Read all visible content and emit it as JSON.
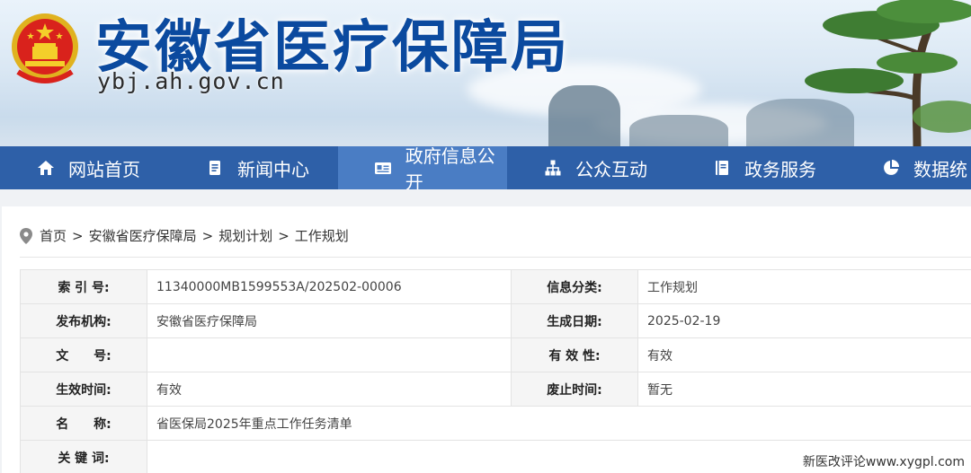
{
  "header": {
    "title": "安徽省医疗保障局",
    "domain": "ybj.ah.gov.cn"
  },
  "nav": {
    "items": [
      {
        "label": "网站首页",
        "icon": "home-icon"
      },
      {
        "label": "新闻中心",
        "icon": "document-icon"
      },
      {
        "label": "政府信息公开",
        "icon": "id-card-icon"
      },
      {
        "label": "公众互动",
        "icon": "sitemap-icon"
      },
      {
        "label": "政务服务",
        "icon": "book-icon"
      },
      {
        "label": "数据统",
        "icon": "pie-chart-icon"
      }
    ],
    "active_index": 2,
    "active_color": "#4a7dc4",
    "bar_color": "#2e60a8"
  },
  "breadcrumb": {
    "items": [
      "首页",
      "安徽省医疗保障局",
      "规划计划",
      "工作规划"
    ],
    "separator": ">"
  },
  "info_table": {
    "index_label": "索 引 号:",
    "index_value": "11340000MB1599553A/202502-00006",
    "category_label": "信息分类:",
    "category_value": "工作规划",
    "publisher_label": "发布机构:",
    "publisher_value": "安徽省医疗保障局",
    "date_label": "生成日期:",
    "date_value": "2025-02-19",
    "doc_no_label": "文　　号:",
    "doc_no_value": "",
    "validity_label": "有 效 性:",
    "validity_value": "有效",
    "effective_label": "生效时间:",
    "effective_value": "有效",
    "expiry_label": "废止时间:",
    "expiry_value": "暂无",
    "name_label": "名　　称:",
    "name_value": "省医保局2025年重点工作任务清单",
    "keywords_label": "关 键 词:",
    "keywords_value": ""
  },
  "watermark": "新医改评论www.xygpl.com"
}
